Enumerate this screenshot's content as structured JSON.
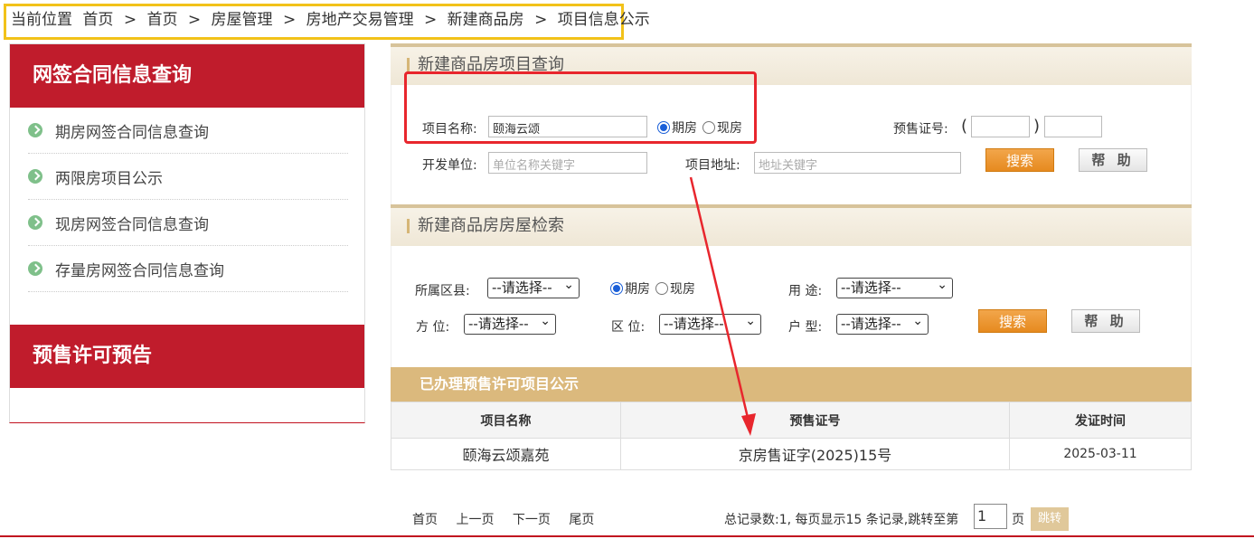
{
  "breadcrumb": {
    "prefix": "当前位置",
    "items": [
      "首页",
      "首页",
      "房屋管理",
      "房地产交易管理",
      "新建商品房",
      "项目信息公示"
    ],
    "separator": ">"
  },
  "sidebar": {
    "section1_title": "网签合同信息查询",
    "items": [
      "期房网签合同信息查询",
      "两限房项目公示",
      "现房网签合同信息查询",
      "存量房网签合同信息查询"
    ],
    "section2_title": "预售许可预告"
  },
  "project_search": {
    "title": "新建商品房项目查询",
    "name_label": "项目名称:",
    "name_value": "颐海云颂",
    "radio_option1": "期房",
    "radio_option2": "现房",
    "presale_label": "预售证号:",
    "paren_open": "(",
    "paren_close": ")",
    "developer_label": "开发单位:",
    "developer_placeholder": "单位名称关键字",
    "address_label": "项目地址:",
    "address_placeholder": "地址关键字",
    "search_button": "搜索",
    "help_button": "帮 助"
  },
  "house_search": {
    "title": "新建商品房房屋检索",
    "district_label": "所属区县:",
    "district_value": "--请选择--",
    "radio_option1": "期房",
    "radio_option2": "现房",
    "usage_label": "用 途:",
    "usage_value": "--请选择--",
    "orientation_label": "方 位:",
    "orientation_value": "--请选择--",
    "zone_label": "区 位:",
    "zone_value": "--请选择--",
    "layout_label": "户 型:",
    "layout_value": "--请选择--",
    "search_button": "搜索",
    "help_button": "帮 助"
  },
  "results": {
    "title": "已办理预售许可项目公示",
    "headers": [
      "项目名称",
      "预售证号",
      "发证时间"
    ],
    "rows": [
      [
        "颐海云颂嘉苑",
        "京房售证字(2025)15号",
        "2025-03-11"
      ]
    ]
  },
  "pager": {
    "first": "首页",
    "prev": "上一页",
    "next": "下一页",
    "last": "尾页",
    "summary": "总记录数:1, 每页显示15 条记录,跳转至第",
    "page_value": "1",
    "page_unit": "页",
    "jump_button": "跳转"
  },
  "colors": {
    "highlight_yellow": "#f2c219",
    "highlight_red": "#e8262d",
    "sidebar_red": "#c01c2c",
    "results_gold": "#dbb97d",
    "button_orange": "#e68a1f"
  }
}
